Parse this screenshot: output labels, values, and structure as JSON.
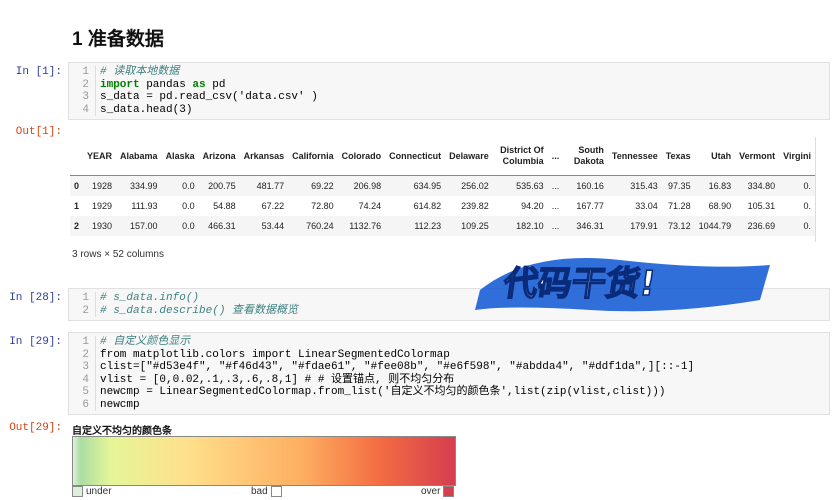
{
  "heading": "1 准备数据",
  "cell1": {
    "prompt": "In [1]:",
    "out_prompt": "Out[1]:",
    "lines": [
      "# 读取本地数据",
      "import pandas as pd",
      "s_data = pd.read_csv('data.csv' )",
      "s_data.head(3)"
    ]
  },
  "table": {
    "columns": [
      "",
      "YEAR",
      "Alabama",
      "Alaska",
      "Arizona",
      "Arkansas",
      "California",
      "Colorado",
      "Connecticut",
      "Delaware",
      "District Of Columbia",
      "...",
      "South Dakota",
      "Tennessee",
      "Texas",
      "Utah",
      "Vermont",
      "Virgini"
    ],
    "rows": [
      [
        "0",
        "1928",
        "334.99",
        "0.0",
        "200.75",
        "481.77",
        "69.22",
        "206.98",
        "634.95",
        "256.02",
        "535.63",
        "...",
        "160.16",
        "315.43",
        "97.35",
        "16.83",
        "334.80",
        "0."
      ],
      [
        "1",
        "1929",
        "111.93",
        "0.0",
        "54.88",
        "67.22",
        "72.80",
        "74.24",
        "614.82",
        "239.82",
        "94.20",
        "...",
        "167.77",
        "33.04",
        "71.28",
        "68.90",
        "105.31",
        "0."
      ],
      [
        "2",
        "1930",
        "157.00",
        "0.0",
        "466.31",
        "53.44",
        "760.24",
        "1132.76",
        "112.23",
        "109.25",
        "182.10",
        "...",
        "346.31",
        "179.91",
        "73.12",
        "1044.79",
        "236.69",
        "0."
      ]
    ],
    "shape": "3 rows × 52 columns"
  },
  "cell28": {
    "prompt": "In [28]:",
    "lines": [
      "# s_data.info()",
      "# s_data.describe() 查看数据概览"
    ]
  },
  "cell29": {
    "prompt": "In [29]:",
    "out_prompt": "Out[29]:",
    "lines": [
      "# 自定义颜色显示",
      "from matplotlib.colors import LinearSegmentedColormap",
      "clist=[\"#d53e4f\", \"#f46d43\", \"#fdae61\", \"#fee08b\", \"#e6f598\", \"#abdda4\", \"#ddf1da\",][::-1]",
      "vlist = [0,0.02,.1,.3,.6,.8,1] # # 设置锚点, 则不均匀分布",
      "newcmp = LinearSegmentedColormap.from_list('自定义不均匀的颜色条',list(zip(vlist,clist)))",
      "newcmp"
    ]
  },
  "colormap": {
    "title": "自定义不均匀的颜色条",
    "under": "under",
    "bad": "bad",
    "over": "over",
    "under_color": "#ddf1da",
    "over_color": "#d53e4f"
  },
  "watermark": "代码干货!"
}
